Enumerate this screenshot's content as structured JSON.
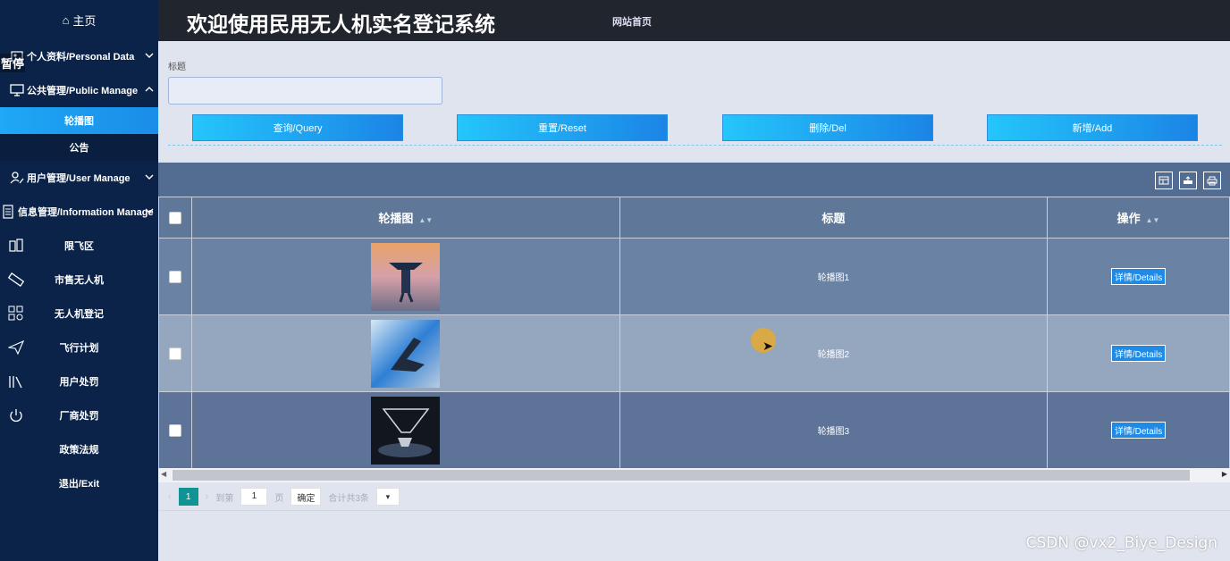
{
  "sidebar": {
    "home": "主页",
    "paused": "暂停",
    "groups": [
      {
        "label": "个人资料/Personal Data"
      },
      {
        "label": "公共管理/Public Manage"
      },
      {
        "label": "用户管理/User Manage"
      },
      {
        "label": "信息管理/Information Manage"
      }
    ],
    "sub_items": [
      "轮播图",
      "公告"
    ],
    "items": [
      "限飞区",
      "市售无人机",
      "无人机登记",
      "飞行计划",
      "用户处罚",
      "厂商处罚",
      "政策法规",
      "退出/Exit"
    ]
  },
  "header": {
    "title": "欢迎使用民用无人机实名登记系统",
    "home_link": "网站首页"
  },
  "search": {
    "label": "标题",
    "placeholder": ""
  },
  "buttons": {
    "query": "查询/Query",
    "reset": "重置/Reset",
    "delete": "删除/Del",
    "add": "新增/Add"
  },
  "table": {
    "columns": [
      "轮播图",
      "标题",
      "操作"
    ],
    "rows": [
      {
        "title": "轮播图1",
        "action": "详情/Details"
      },
      {
        "title": "轮播图2",
        "action": "详情/Details"
      },
      {
        "title": "轮播图3",
        "action": "详情/Details"
      }
    ]
  },
  "pager": {
    "current": "1",
    "goto_label": "到第",
    "page_input": "1",
    "page_unit": "页",
    "confirm": "确定",
    "total": "合计共3条"
  },
  "watermark": "CSDN @vx2_Biye_Design"
}
